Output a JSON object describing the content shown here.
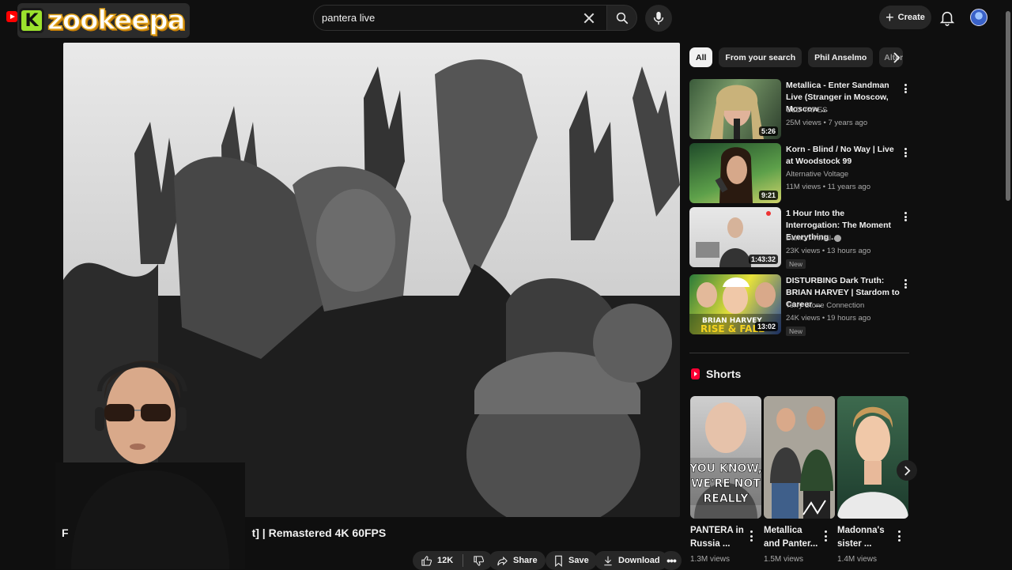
{
  "brand": {
    "name": "zookeepa",
    "badge_letter": "K"
  },
  "search": {
    "value": "pantera live"
  },
  "header": {
    "create_label": "Create"
  },
  "video": {
    "title": "F",
    "title_tail": "t] | Remastered 4K 60FPS",
    "likes": "12K",
    "share_label": "Share",
    "save_label": "Save",
    "download_label": "Download"
  },
  "chips": [
    {
      "label": "All",
      "active": true
    },
    {
      "label": "From your search"
    },
    {
      "label": "Phil Anselmo"
    },
    {
      "label": "Altern"
    }
  ],
  "recommendations": [
    {
      "title": "Metallica - Enter Sandman Live (Stranger in Moscow, Moscow ...",
      "channel": "OLD TAPES",
      "meta": "25M views • 7 years ago",
      "duration": "5:26",
      "badge": ""
    },
    {
      "title": "Korn - Blind / No Way | Live at Woodstock 99",
      "channel": "Alternative Voltage",
      "meta": "11M views • 11 years ago",
      "duration": "9:21",
      "badge": ""
    },
    {
      "title": "1 Hour Into the Interrogation: The Moment Everything ...",
      "channel": "Damon Verial",
      "meta": "23K views • 13 hours ago",
      "duration": "1:43:32",
      "badge": "New"
    },
    {
      "title": "DISTURBING Dark Truth: BRIAN HARVEY | Stardom to Career ...",
      "channel": "Terry Stone Connection",
      "meta": "24K views • 19 hours ago",
      "duration": "13:02",
      "badge": "New"
    }
  ],
  "thumb_text": {
    "brian_1": "BRIAN HARVEY",
    "brian_2": "RISE & FALL"
  },
  "shorts": {
    "heading": "Shorts",
    "items": [
      {
        "title": "PANTERA in Russia ...",
        "views": "1.3M views",
        "overlay": "YOU KNOW, WE'RE NOT REALLY"
      },
      {
        "title": "Metallica and Panter...",
        "views": "1.5M views",
        "overlay": ""
      },
      {
        "title": "Madonna's sister ...",
        "views": "1.4M views",
        "overlay": ""
      }
    ]
  },
  "colors": {
    "background": "#0f0f0f",
    "accent_red": "#ff0033",
    "brand_green": "#9be22d",
    "brand_gold": "#e0a21a"
  }
}
